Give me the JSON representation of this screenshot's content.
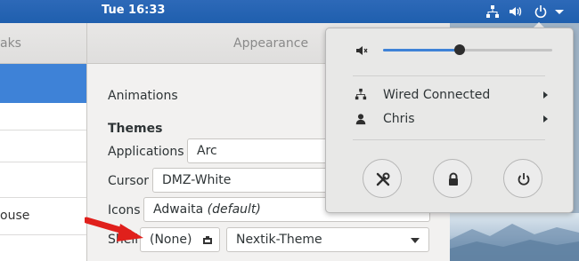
{
  "topbar": {
    "clock": "Tue 16:33",
    "icons": [
      "network-wired-icon",
      "volume-icon",
      "power-icon",
      "dropdown-arrow-icon"
    ]
  },
  "window": {
    "left_title": "aks",
    "title": "Appearance",
    "sidebar_items": [
      "",
      "",
      "",
      "",
      "ouse",
      ""
    ],
    "animations_label": "Animations",
    "themes_heading": "Themes",
    "rows": {
      "applications": {
        "label": "Applications",
        "value": "Arc"
      },
      "cursor": {
        "label": "Cursor",
        "value": "DMZ-White"
      },
      "icons": {
        "label": "Icons",
        "value": "Adwaita",
        "suffix": "(default)"
      },
      "shell": {
        "label": "Shell",
        "status": "(None)",
        "value": "Nextik-Theme"
      }
    }
  },
  "system_menu": {
    "volume_level": 0.45,
    "items": [
      {
        "label": "Wired Connected",
        "icon": "network-wired-icon"
      },
      {
        "label": "Chris",
        "icon": "user-icon"
      }
    ],
    "buttons": [
      "settings-icon",
      "lock-icon",
      "power-icon"
    ]
  },
  "colors": {
    "topbar": "#1f5fae",
    "accent": "#3e82d7",
    "annotation": "#e0201c"
  }
}
